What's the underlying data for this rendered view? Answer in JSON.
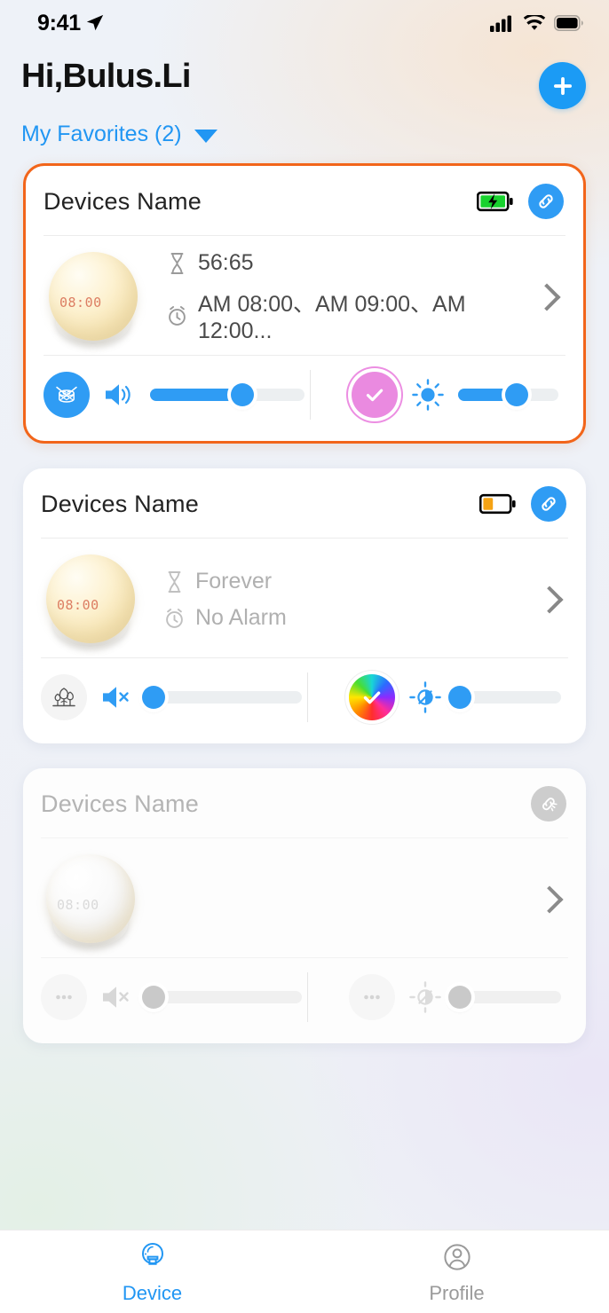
{
  "status_bar": {
    "time": "9:41",
    "location_icon": "location-arrow-icon",
    "signal_icon": "cellular-signal-icon",
    "wifi_icon": "wifi-icon",
    "battery_icon": "battery-full-icon"
  },
  "header": {
    "greeting": "Hi,Bulus.Li",
    "add_button_label": "+",
    "favorites_label": "My Favorites (2)"
  },
  "devices": [
    {
      "name": "Devices  Name",
      "selected": true,
      "online": true,
      "battery_state": "charging",
      "battery_percent": 100,
      "link_state": "linked",
      "timer": "56:65",
      "alarms": "AM 08:00、AM 09:00、AM 12:00...",
      "lamp_display": "08:00",
      "sound_mode": "drum-icon",
      "sound_muted": false,
      "volume_percent": 60,
      "color_mode": "pink",
      "color_hex": "#ea8ae0",
      "brightness_on": true,
      "brightness_percent": 60
    },
    {
      "name": "Devices  Name",
      "selected": false,
      "online": true,
      "battery_state": "low",
      "battery_percent": 40,
      "link_state": "linked",
      "timer": "Forever",
      "alarms": "No Alarm",
      "lamp_display": "08:00",
      "sound_mode": "forest-icon",
      "sound_muted": true,
      "volume_percent": 0,
      "color_mode": "rainbow",
      "color_hex": "rainbow",
      "brightness_on": false,
      "brightness_percent": 0
    },
    {
      "name": "Devices  Name",
      "selected": false,
      "online": false,
      "battery_state": "none",
      "battery_percent": 0,
      "link_state": "disconnected",
      "timer": "",
      "alarms": "",
      "lamp_display": "08:00",
      "sound_mode": "ellipsis-icon",
      "sound_muted": true,
      "volume_percent": 0,
      "color_mode": "ellipsis-icon",
      "color_hex": "#d8d8d8",
      "brightness_on": false,
      "brightness_percent": 0
    }
  ],
  "tabbar": {
    "tabs": [
      {
        "label": "Device",
        "icon": "lamp-icon",
        "active": true
      },
      {
        "label": "Profile",
        "icon": "person-icon",
        "active": false
      }
    ]
  },
  "colors": {
    "accent_blue": "#2196f3",
    "selected_border": "#f2651a",
    "pink": "#ea8ae0",
    "battery_green": "#18d22e",
    "battery_orange": "#f5a314",
    "muted_text": "#b0b0b0"
  }
}
